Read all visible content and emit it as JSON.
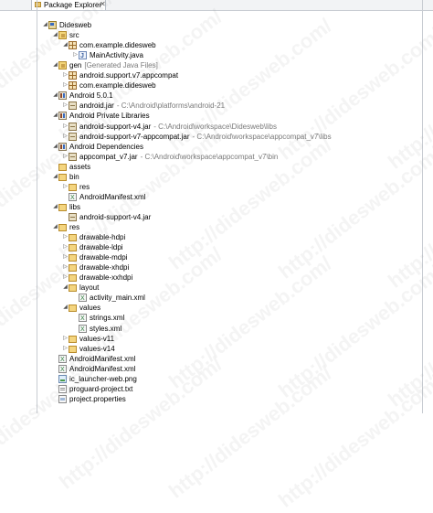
{
  "view": {
    "title": "Package Explorer",
    "close_glyph": "✕"
  },
  "watermark": "http://didesweb.com/",
  "tree": [
    {
      "depth": 0,
      "toggle": "open",
      "icon": "project",
      "label": "Didesweb",
      "decor": ""
    },
    {
      "depth": 1,
      "toggle": "open",
      "icon": "srcfolder",
      "label": "src",
      "decor": ""
    },
    {
      "depth": 2,
      "toggle": "open",
      "icon": "package",
      "label": "com.example.didesweb",
      "decor": ""
    },
    {
      "depth": 3,
      "toggle": "closed",
      "icon": "javafile",
      "label": "MainActivity.java",
      "decor": ""
    },
    {
      "depth": 1,
      "toggle": "open",
      "icon": "srcfolder",
      "label": "gen",
      "decor": "[Generated Java Files]"
    },
    {
      "depth": 2,
      "toggle": "closed",
      "icon": "package",
      "label": "android.support.v7.appcompat",
      "decor": ""
    },
    {
      "depth": 2,
      "toggle": "closed",
      "icon": "package",
      "label": "com.example.didesweb",
      "decor": ""
    },
    {
      "depth": 1,
      "toggle": "open",
      "icon": "library",
      "label": "Android 5.0.1",
      "decor": ""
    },
    {
      "depth": 2,
      "toggle": "closed",
      "icon": "jar",
      "label": "android.jar",
      "decor": "- C:\\Android\\platforms\\android-21"
    },
    {
      "depth": 1,
      "toggle": "open",
      "icon": "library",
      "label": "Android Private Libraries",
      "decor": ""
    },
    {
      "depth": 2,
      "toggle": "closed",
      "icon": "jar",
      "label": "android-support-v4.jar",
      "decor": "- C:\\Android\\workspace\\Didesweb\\libs"
    },
    {
      "depth": 2,
      "toggle": "closed",
      "icon": "jar",
      "label": "android-support-v7-appcompat.jar",
      "decor": "- C:\\Android\\workspace\\appcompat_v7\\libs"
    },
    {
      "depth": 1,
      "toggle": "open",
      "icon": "library",
      "label": "Android Dependencies",
      "decor": ""
    },
    {
      "depth": 2,
      "toggle": "closed",
      "icon": "jar",
      "label": "appcompat_v7.jar",
      "decor": "- C:\\Android\\workspace\\appcompat_v7\\bin"
    },
    {
      "depth": 1,
      "toggle": "none",
      "icon": "folder",
      "label": "assets",
      "decor": ""
    },
    {
      "depth": 1,
      "toggle": "open",
      "icon": "folder",
      "label": "bin",
      "decor": ""
    },
    {
      "depth": 2,
      "toggle": "closed",
      "icon": "folder",
      "label": "res",
      "decor": ""
    },
    {
      "depth": 2,
      "toggle": "none",
      "icon": "xmlfile",
      "label": "AndroidManifest.xml",
      "decor": ""
    },
    {
      "depth": 1,
      "toggle": "open",
      "icon": "folder",
      "label": "libs",
      "decor": ""
    },
    {
      "depth": 2,
      "toggle": "none",
      "icon": "jar",
      "label": "android-support-v4.jar",
      "decor": ""
    },
    {
      "depth": 1,
      "toggle": "open",
      "icon": "folder",
      "label": "res",
      "decor": ""
    },
    {
      "depth": 2,
      "toggle": "closed",
      "icon": "folder",
      "label": "drawable-hdpi",
      "decor": ""
    },
    {
      "depth": 2,
      "toggle": "closed",
      "icon": "folder",
      "label": "drawable-ldpi",
      "decor": ""
    },
    {
      "depth": 2,
      "toggle": "closed",
      "icon": "folder",
      "label": "drawable-mdpi",
      "decor": ""
    },
    {
      "depth": 2,
      "toggle": "closed",
      "icon": "folder",
      "label": "drawable-xhdpi",
      "decor": ""
    },
    {
      "depth": 2,
      "toggle": "closed",
      "icon": "folder",
      "label": "drawable-xxhdpi",
      "decor": ""
    },
    {
      "depth": 2,
      "toggle": "open",
      "icon": "folder",
      "label": "layout",
      "decor": ""
    },
    {
      "depth": 3,
      "toggle": "none",
      "icon": "xmlfile",
      "label": "activity_main.xml",
      "decor": ""
    },
    {
      "depth": 2,
      "toggle": "open",
      "icon": "folder",
      "label": "values",
      "decor": ""
    },
    {
      "depth": 3,
      "toggle": "none",
      "icon": "xmlfile",
      "label": "strings.xml",
      "decor": ""
    },
    {
      "depth": 3,
      "toggle": "none",
      "icon": "xmlfile",
      "label": "styles.xml",
      "decor": ""
    },
    {
      "depth": 2,
      "toggle": "closed",
      "icon": "folder",
      "label": "values-v11",
      "decor": ""
    },
    {
      "depth": 2,
      "toggle": "closed",
      "icon": "folder",
      "label": "values-v14",
      "decor": ""
    },
    {
      "depth": 1,
      "toggle": "none",
      "icon": "xmlfile",
      "label": "AndroidManifest.xml",
      "decor": ""
    },
    {
      "depth": 1,
      "toggle": "none",
      "icon": "xmlfile",
      "label": "AndroidManifest.xml",
      "decor": ""
    },
    {
      "depth": 1,
      "toggle": "none",
      "icon": "imagefile",
      "label": "ic_launcher-web.png",
      "decor": ""
    },
    {
      "depth": 1,
      "toggle": "none",
      "icon": "textfile",
      "label": "proguard-project.txt",
      "decor": ""
    },
    {
      "depth": 1,
      "toggle": "none",
      "icon": "propfile",
      "label": "project.properties",
      "decor": ""
    }
  ]
}
